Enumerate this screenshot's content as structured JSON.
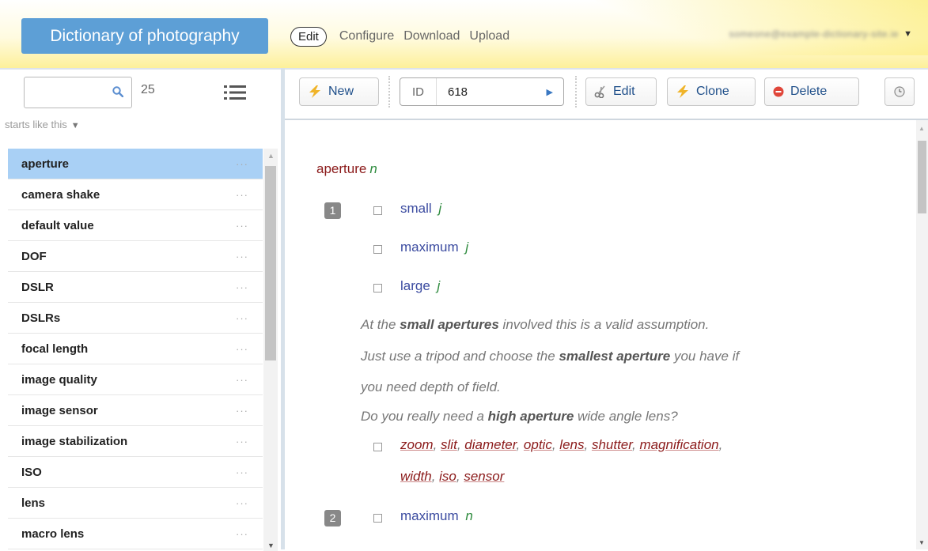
{
  "app": {
    "title": "Dictionary of photography"
  },
  "top_nav": {
    "edit": "Edit",
    "configure": "Configure",
    "download": "Download",
    "upload": "Upload"
  },
  "user": {
    "name": "someone@example-dictionary-site.ie"
  },
  "sidebar": {
    "search": {
      "value": "",
      "placeholder": ""
    },
    "count": "25",
    "filter": "starts like this",
    "dots": "···",
    "items": [
      {
        "label": "aperture",
        "selected": true
      },
      {
        "label": "camera shake"
      },
      {
        "label": "default value"
      },
      {
        "label": "DOF"
      },
      {
        "label": "DSLR"
      },
      {
        "label": "DSLRs"
      },
      {
        "label": "focal length"
      },
      {
        "label": "image quality"
      },
      {
        "label": "image sensor"
      },
      {
        "label": "image stabilization"
      },
      {
        "label": "ISO"
      },
      {
        "label": "lens"
      },
      {
        "label": "macro lens"
      }
    ]
  },
  "toolbar": {
    "new": "New",
    "id_label": "ID",
    "id_value": "618",
    "edit": "Edit",
    "clone": "Clone",
    "delete": "Delete"
  },
  "entry": {
    "headword": "aperture",
    "pos": "n",
    "sense1": {
      "number": "1",
      "collocates": [
        {
          "word": "small",
          "pos": "j"
        },
        {
          "word": "maximum",
          "pos": "j"
        },
        {
          "word": "large",
          "pos": "j"
        }
      ],
      "examples": [
        {
          "pre": "At the ",
          "bold": "small apertures",
          "post": " involved this is a valid assumption."
        },
        {
          "pre": "Just use a tripod and choose the ",
          "bold": "smallest aperture",
          "post": " you have if"
        },
        {
          "pre": "you need depth of field.",
          "bold": "",
          "post": ""
        },
        {
          "pre": "Do you really need a ",
          "bold": "high aperture",
          "post": " wide angle lens?"
        }
      ],
      "synonyms_line1": [
        "zoom",
        "slit",
        "diameter",
        "optic",
        "lens",
        "shutter",
        "magnification"
      ],
      "synonyms_line2": [
        "width",
        "iso",
        "sensor"
      ]
    },
    "sense2": {
      "number": "2",
      "word": "maximum",
      "pos": "n"
    }
  }
}
